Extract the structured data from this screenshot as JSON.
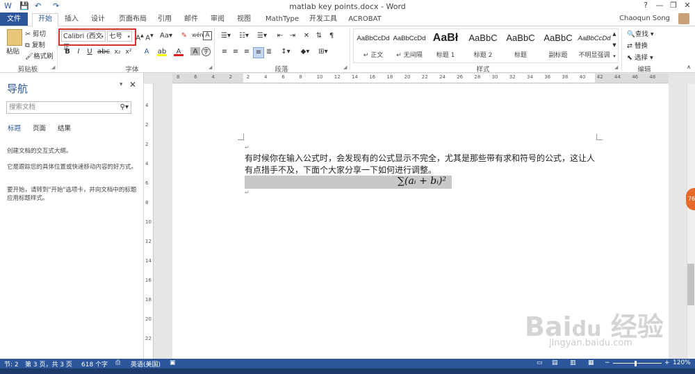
{
  "window": {
    "title": "matlab key points.docx - Word",
    "minimize": "—",
    "restore": "❐",
    "close": "✕",
    "help": "?"
  },
  "qat": {
    "save": "💾",
    "undo": "↶",
    "redo": "↷"
  },
  "tabs": [
    "文件",
    "开始",
    "插入",
    "设计",
    "页面布局",
    "引用",
    "邮件",
    "审阅",
    "视图",
    "MathType",
    "开发工具",
    "ACROBAT"
  ],
  "user": {
    "name": "Chaoqun Song"
  },
  "ribbon": {
    "clipboard": {
      "paste": "粘贴",
      "cut": "剪切",
      "copy": "复制",
      "format_painter": "格式刷",
      "label": "剪贴板"
    },
    "font": {
      "font_name": "Calibri (西文正",
      "font_size": "七号",
      "label": "字体"
    },
    "paragraph": {
      "label": "段落"
    },
    "styles": {
      "label": "样式",
      "items": [
        {
          "preview": "AaBbCcDd",
          "name": "↵ 正文"
        },
        {
          "preview": "AaBbCcDd",
          "name": "↵ 无间隔"
        },
        {
          "preview": "AaBł",
          "name": "标题 1"
        },
        {
          "preview": "AaBbC",
          "name": "标题 2"
        },
        {
          "preview": "AaBbC",
          "name": "标题"
        },
        {
          "preview": "AaBbC",
          "name": "副标题"
        },
        {
          "preview": "AaBbCcDd",
          "name": "不明显强调"
        }
      ]
    },
    "editing": {
      "find": "查找",
      "replace": "替换",
      "select": "选择",
      "label": "编辑"
    }
  },
  "nav": {
    "title": "导航",
    "search_placeholder": "搜索文档",
    "tabs": [
      "标题",
      "页面",
      "结果"
    ],
    "text1": "创建文档的交互式大纲。",
    "text2": "它是跟踪您的具体位置或快速移动内容的好方式。",
    "text3": "要开始，请转到\"开始\"选项卡，并向文档中的标题应用标题样式。"
  },
  "ruler": {
    "numbers": [
      "8",
      "6",
      "4",
      "2",
      "2",
      "4",
      "6",
      "8",
      "10",
      "12",
      "14",
      "16",
      "18",
      "20",
      "22",
      "24",
      "26",
      "28",
      "30",
      "32",
      "34",
      "36",
      "38",
      "40",
      "42",
      "44",
      "46",
      "48"
    ]
  },
  "vruler": {
    "numbers": [
      "4",
      "2",
      "2",
      "4",
      "6",
      "8",
      "10",
      "12",
      "14",
      "16",
      "18",
      "20",
      "22"
    ]
  },
  "document": {
    "paragraph": "有时候你在输入公式时，会发现有的公式显示不完全，尤其是那些带有求和符号的公式，这让人有点措手不及，下面个大家分享一下如何进行调整。",
    "formula": "∑(aᵢ + bᵢ)²"
  },
  "status": {
    "section": "节: 2",
    "page": "第 3 页，共 3 页",
    "words": "618 个字",
    "language": "英语(美国)",
    "zoom": "120%"
  },
  "watermark": {
    "main": "Bai 经验",
    "sub": "jingyan.baidu.com"
  }
}
